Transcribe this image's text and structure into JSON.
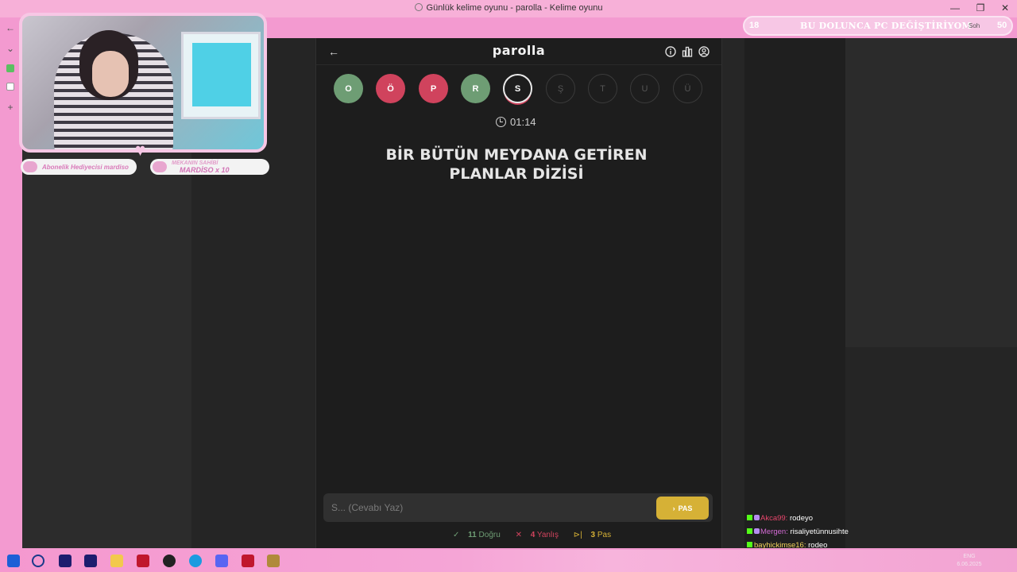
{
  "window": {
    "title": "Günlük kelime oyunu - parolla - Kelime oyunu",
    "minimize": "—",
    "restore": "❐",
    "close": "✕"
  },
  "browser_sidebar": {
    "back": "←",
    "chevron": "⌄",
    "add": "+"
  },
  "game": {
    "back_arrow": "←",
    "title": "parolla",
    "letters": [
      {
        "char": "O",
        "state": "correct"
      },
      {
        "char": "Ö",
        "state": "wrong"
      },
      {
        "char": "P",
        "state": "wrong"
      },
      {
        "char": "R",
        "state": "correct"
      },
      {
        "char": "S",
        "state": "current"
      },
      {
        "char": "Ş",
        "state": "pending"
      },
      {
        "char": "T",
        "state": "pending"
      },
      {
        "char": "U",
        "state": "pending"
      },
      {
        "char": "Ü",
        "state": "pending"
      }
    ],
    "timer": "01:14",
    "question_line1": "BİR BÜTÜN MEYDANA GETİREN",
    "question_line2": "PLANLAR DİZİSİ",
    "input_placeholder": "S... (Cevabı Yaz)",
    "pas_label": "PAS",
    "pas_arrow": "›",
    "stats": {
      "correct_icon": "✓",
      "correct_count": "11",
      "correct_label": "Doğru",
      "wrong_icon": "✕",
      "wrong_count": "4",
      "wrong_label": "Yanlış",
      "pass_icon": "⊳|",
      "pass_count": "3",
      "pass_label": "Pas"
    },
    "colors": {
      "correct": "#6e9d74",
      "wrong": "#d0435d",
      "accent": "#d6b136"
    }
  },
  "overlay": {
    "sub_gifter": "Abonelik Hediyecisi mardiso",
    "owner_label": "MEKANIN SAHİBİ",
    "owner_value": "MARDİSO x 10",
    "goal_current": "18",
    "goal_text": "BU DOLUNCA PC DEĞİŞTİRİYOM",
    "goal_target": "50",
    "sohbet": "Soh"
  },
  "chat": [
    {
      "user": "Akca99:",
      "message": "rodeyo"
    },
    {
      "user": "Mergen:",
      "message": "risaliyetünnusihte"
    },
    {
      "user": "bayhickimse16:",
      "message": "rodeo"
    }
  ],
  "taskbar": {
    "lang": "ENG",
    "date": "6.06.2025"
  }
}
